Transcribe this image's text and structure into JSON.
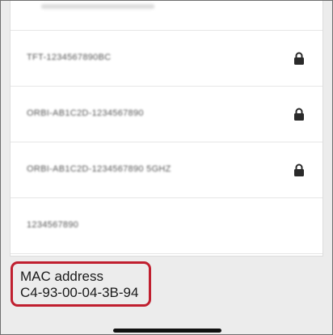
{
  "wifi_list": {
    "networks": [
      {
        "name": "TFT-1234567890BC",
        "locked": true,
        "lock_icon": "lock-icon"
      },
      {
        "name": "ORBI-AB1C2D-1234567890",
        "locked": true,
        "lock_icon": "lock-icon"
      },
      {
        "name": "ORBI-AB1C2D-1234567890 5GHZ",
        "locked": true,
        "lock_icon": "lock-icon"
      },
      {
        "name": "1234567890",
        "locked": false
      }
    ]
  },
  "device_info": {
    "mac_label": "MAC address",
    "mac_value": "C4-93-00-04-3B-94",
    "highlight_color": "#c01f2f"
  },
  "system": {
    "home_indicator": "home-indicator"
  }
}
